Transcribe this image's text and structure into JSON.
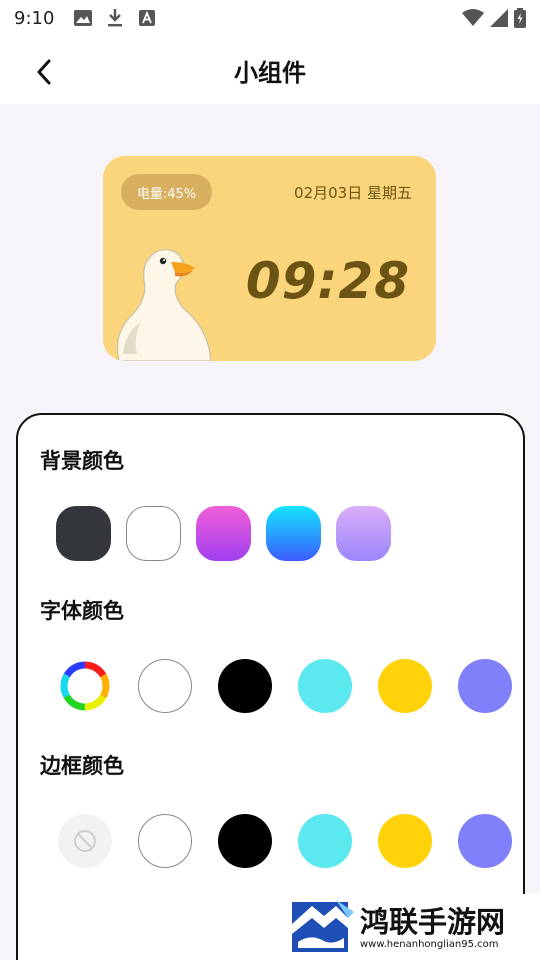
{
  "status_bar": {
    "time": "9:10",
    "left_icons": [
      "image-icon",
      "download-icon",
      "font-icon"
    ],
    "right_icons": [
      "wifi-icon",
      "signal-icon",
      "battery-icon"
    ]
  },
  "header": {
    "title": "小组件",
    "back_icon": "chevron-left-icon"
  },
  "widget_preview": {
    "battery": "电量:45%",
    "date": "02月03日 星期五",
    "time": "09:28",
    "background_color": "#fbd57b",
    "text_color": "#6b5313",
    "image": "duck-illustration"
  },
  "settings": {
    "background_color": {
      "title": "背景颜色",
      "options": [
        "dark-gray",
        "white",
        "pink-purple-gradient",
        "cyan-blue-gradient",
        "lavender-gradient"
      ]
    },
    "font_color": {
      "title": "字体颜色",
      "options": [
        "color-wheel",
        "#ffffff",
        "#000000",
        "#5ce8ef",
        "#ffd20a",
        "#8080fa"
      ]
    },
    "border_color": {
      "title": "边框颜色",
      "options": [
        "none",
        "#ffffff",
        "#000000",
        "#5ce8ef",
        "#ffd20a",
        "#8080fa"
      ]
    }
  },
  "watermark": {
    "title": "鸿联手游网",
    "url": "www.henanhonglian95.com"
  }
}
